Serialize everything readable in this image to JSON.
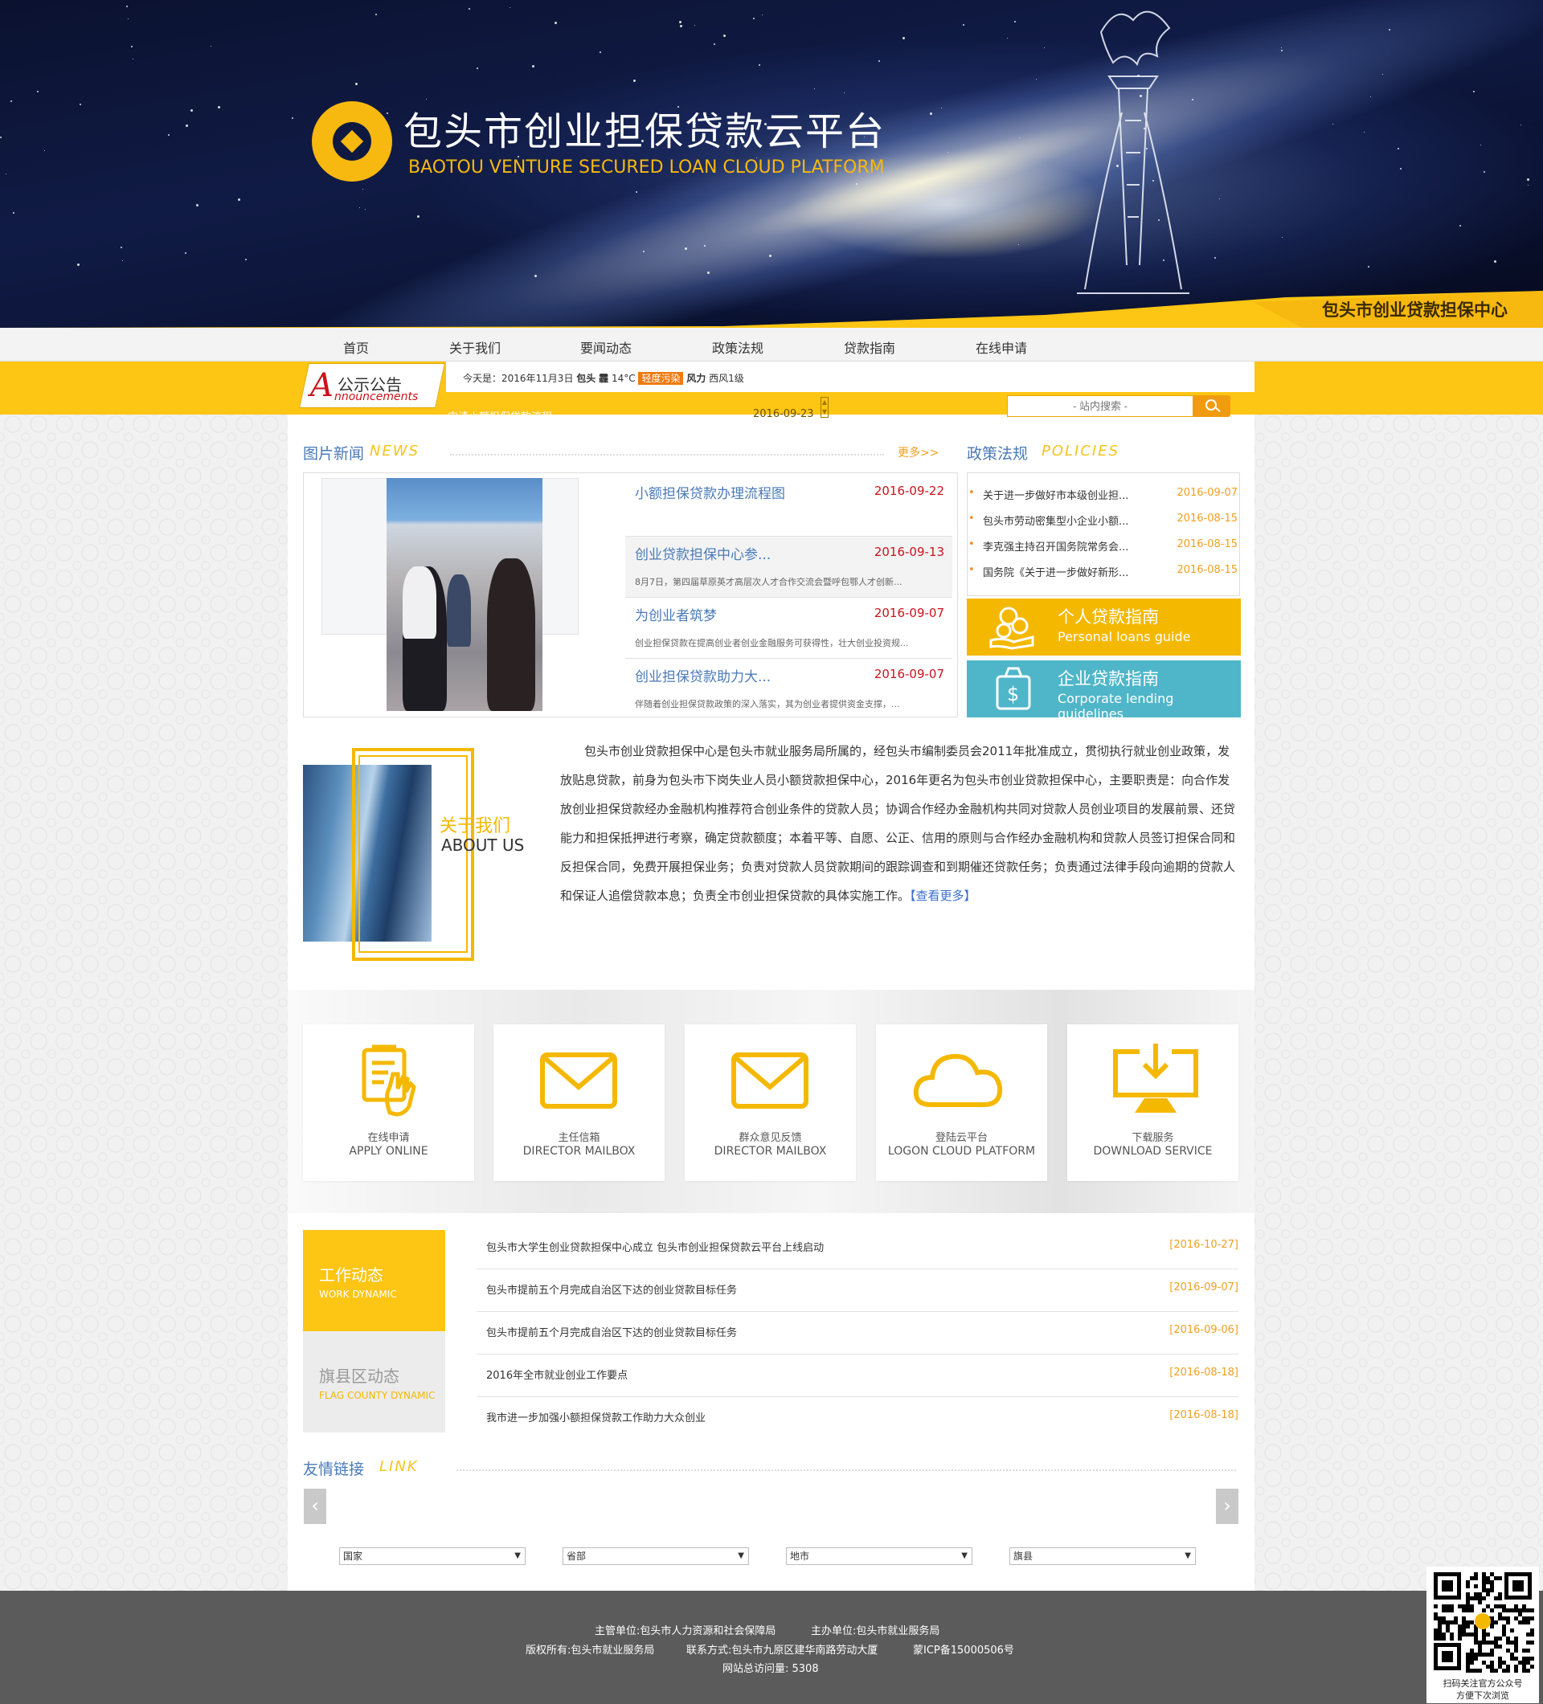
{
  "banner": {
    "logo_cn": "包头市创业担保贷款云平台",
    "logo_en": "BAOTOU VENTURE SECURED LOAN CLOUD PLATFORM",
    "center_name": "包头市创业贷款担保中心"
  },
  "nav": [
    "首页",
    "关于我们",
    "要闻动态",
    "政策法规",
    "贷款指南",
    "在线申请"
  ],
  "announcement": {
    "label_cn": "公示公告",
    "label_a": "A",
    "label_en": "nnouncements",
    "weather_prefix": "今天是：2016年11月3日",
    "city": "包头",
    "weather_icon": "霾",
    "temp": "14°C",
    "pollution": "轻度污染",
    "wind_label": "风力",
    "wind": "西风1级",
    "title": "申请小额担保贷款流程",
    "date": "2016-09-23"
  },
  "search": {
    "placeholder": "- 站内搜索 -"
  },
  "news": {
    "title": "图片新闻",
    "title_en": "NEWS",
    "more": "更多>>",
    "items": [
      {
        "title": "小额担保贷款办理流程图",
        "date": "2016-09-22",
        "summary": ""
      },
      {
        "title": "创业贷款担保中心参...",
        "date": "2016-09-13",
        "summary": "8月7日，第四届草原英才高层次人才合作交流会暨呼包鄂人才创新..."
      },
      {
        "title": "为创业者筑梦",
        "date": "2016-09-07",
        "summary": "创业担保贷款在提高创业者创业金融服务可获得性，壮大创业投资规..."
      },
      {
        "title": "创业担保贷款助力大...",
        "date": "2016-09-07",
        "summary": "伴随着创业担保贷款政策的深入落实，其为创业者提供资金支撑，..."
      }
    ]
  },
  "policies": {
    "title": "政策法规",
    "title_en": "POLICIES",
    "items": [
      {
        "title": "关于进一步做好市本级创业担...",
        "date": "2016-09-07"
      },
      {
        "title": "包头市劳动密集型小企业小额...",
        "date": "2016-08-15"
      },
      {
        "title": "李克强主持召开国务院常务会...",
        "date": "2016-08-15"
      },
      {
        "title": "国务院《关于进一步做好新形...",
        "date": "2016-08-15"
      }
    ]
  },
  "guides": [
    {
      "cn": "个人贷款指南",
      "en": "Personal loans guide",
      "color": "#f5b800"
    },
    {
      "cn": "企业贷款指南",
      "en": "Corporate lending guidelines",
      "color": "#4fb6c9"
    }
  ],
  "about": {
    "title_cn": "关于我们",
    "title_en": "ABOUT US",
    "text": "包头市创业贷款担保中心是包头市就业服务局所属的，经包头市编制委员会2011年批准成立，贯彻执行就业创业政策，发放贴息贷款，前身为包头市下岗失业人员小额贷款担保中心，2016年更名为包头市创业贷款担保中心，主要职责是：向合作发放创业担保贷款经办金融机构推荐符合创业条件的贷款人员；协调合作经办金融机构共同对贷款人员创业项目的发展前景、还贷能力和担保抵押进行考察，确定贷款额度；本着平等、自愿、公正、信用的原则与合作经办金融机构和贷款人员签订担保合同和反担保合同，免费开展担保业务；负责对贷款人员贷款期间的跟踪调查和到期催还贷款任务；负责通过法律手段向逾期的贷款人和保证人追偿贷款本息；负责全市创业担保贷款的具体实施工作。",
    "more": "【查看更多】"
  },
  "services": [
    {
      "cn": "在线申请",
      "en": "APPLY ONLINE",
      "icon": "hand-form-icon"
    },
    {
      "cn": "主任信箱",
      "en": "DIRECTOR MAILBOX",
      "icon": "envelope-icon"
    },
    {
      "cn": "群众意见反馈",
      "en": "DIRECTOR MAILBOX",
      "icon": "envelope-icon"
    },
    {
      "cn": "登陆云平台",
      "en": "LOGON CLOUD PLATFORM",
      "icon": "cloud-icon"
    },
    {
      "cn": "下载服务",
      "en": "DOWNLOAD SERVICE",
      "icon": "download-monitor-icon"
    }
  ],
  "dynamics": {
    "tabs": [
      {
        "cn": "工作动态",
        "en": "WORK DYNAMIC"
      },
      {
        "cn": "旗县区动态",
        "en": "FLAG COUNTY DYNAMIC"
      }
    ],
    "items": [
      {
        "title": "包头市大学生创业贷款担保中心成立 包头市创业担保贷款云平台上线启动",
        "date": "[2016-10-27]"
      },
      {
        "title": "包头市提前五个月完成自治区下达的创业贷款目标任务",
        "date": "[2016-09-07]"
      },
      {
        "title": "包头市提前五个月完成自治区下达的创业贷款目标任务",
        "date": "[2016-09-06]"
      },
      {
        "title": "2016年全市就业创业工作要点",
        "date": "[2016-08-18]"
      },
      {
        "title": "我市进一步加强小额担保贷款工作助力大众创业",
        "date": "[2016-08-18]"
      }
    ]
  },
  "links": {
    "title": "友情链接",
    "title_en": "LINK",
    "selects": [
      "国家",
      "省部",
      "地市",
      "旗县"
    ]
  },
  "footer": {
    "line1a": "主管单位:包头市人力资源和社会保障局",
    "line1b": "主办单位:包头市就业服务局",
    "line2a": "版权所有:包头市就业服务局",
    "line2b": "联系方式:包头市九原区建华南路劳动大厦",
    "line2c": "蒙ICP备15000506号",
    "line3": "网站总访问量: 5308",
    "qr_caption1": "扫码关注官方公众号",
    "qr_caption2": "方便下次浏览"
  }
}
